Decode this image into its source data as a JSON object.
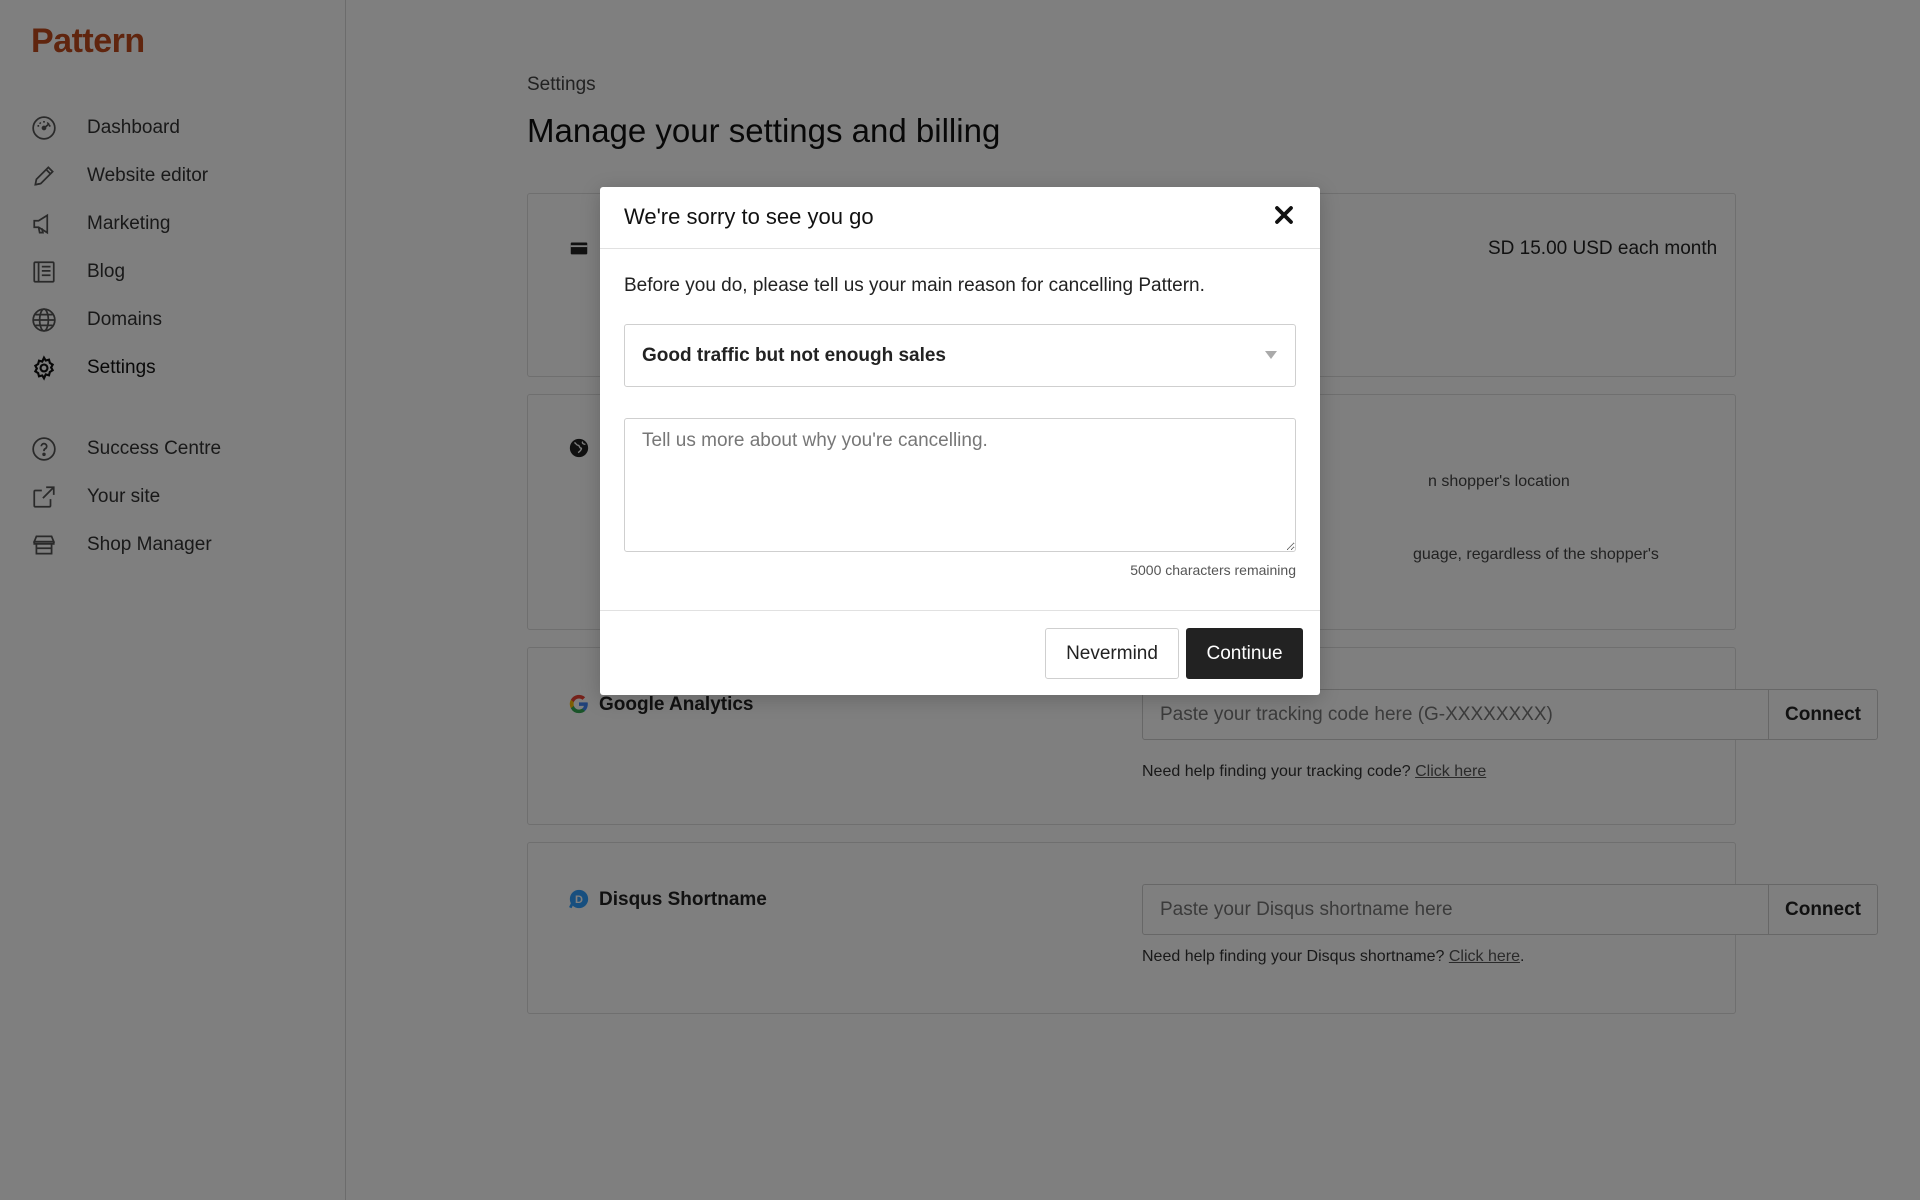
{
  "brand": {
    "name": "Pattern",
    "color": "#c04a1c"
  },
  "sidebar": {
    "items": [
      {
        "label": "Dashboard",
        "icon": "dashboard-icon"
      },
      {
        "label": "Website editor",
        "icon": "pencil-icon"
      },
      {
        "label": "Marketing",
        "icon": "megaphone-icon"
      },
      {
        "label": "Blog",
        "icon": "blog-icon"
      },
      {
        "label": "Domains",
        "icon": "globe-icon"
      },
      {
        "label": "Settings",
        "icon": "gear-icon",
        "active": true
      }
    ],
    "secondary": [
      {
        "label": "Success Centre",
        "icon": "question-circle-icon"
      },
      {
        "label": "Your site",
        "icon": "external-link-icon"
      },
      {
        "label": "Shop Manager",
        "icon": "shop-icon"
      }
    ]
  },
  "header": {
    "breadcrumb": "Settings",
    "title": "Manage your settings and billing"
  },
  "billing": {
    "text": "SD 15.00 USD each month"
  },
  "language": {
    "line1": "n shopper's location",
    "line2": "guage, regardless of the shopper's"
  },
  "analytics": {
    "label": "Google Analytics",
    "placeholder": "Paste your tracking code here (G-XXXXXXXX)",
    "connect": "Connect",
    "help_text": "Need help finding your tracking code?",
    "help_link": "Click here"
  },
  "disqus": {
    "label": "Disqus Shortname",
    "placeholder": "Paste your Disqus shortname here",
    "connect": "Connect",
    "help_text": "Need help finding your Disqus shortname?",
    "help_link": "Click here",
    "help_suffix": "."
  },
  "modal": {
    "title": "We're sorry to see you go",
    "intro": "Before you do, please tell us your main reason for cancelling Pattern.",
    "selected_reason": "Good traffic but not enough sales",
    "textarea_placeholder": "Tell us more about why you're cancelling.",
    "char_count": "5000 characters remaining",
    "nevermind": "Nevermind",
    "continue": "Continue"
  },
  "colors": {
    "overlay": "rgba(0,0,0,0.5)",
    "primary_button": "#222222"
  }
}
